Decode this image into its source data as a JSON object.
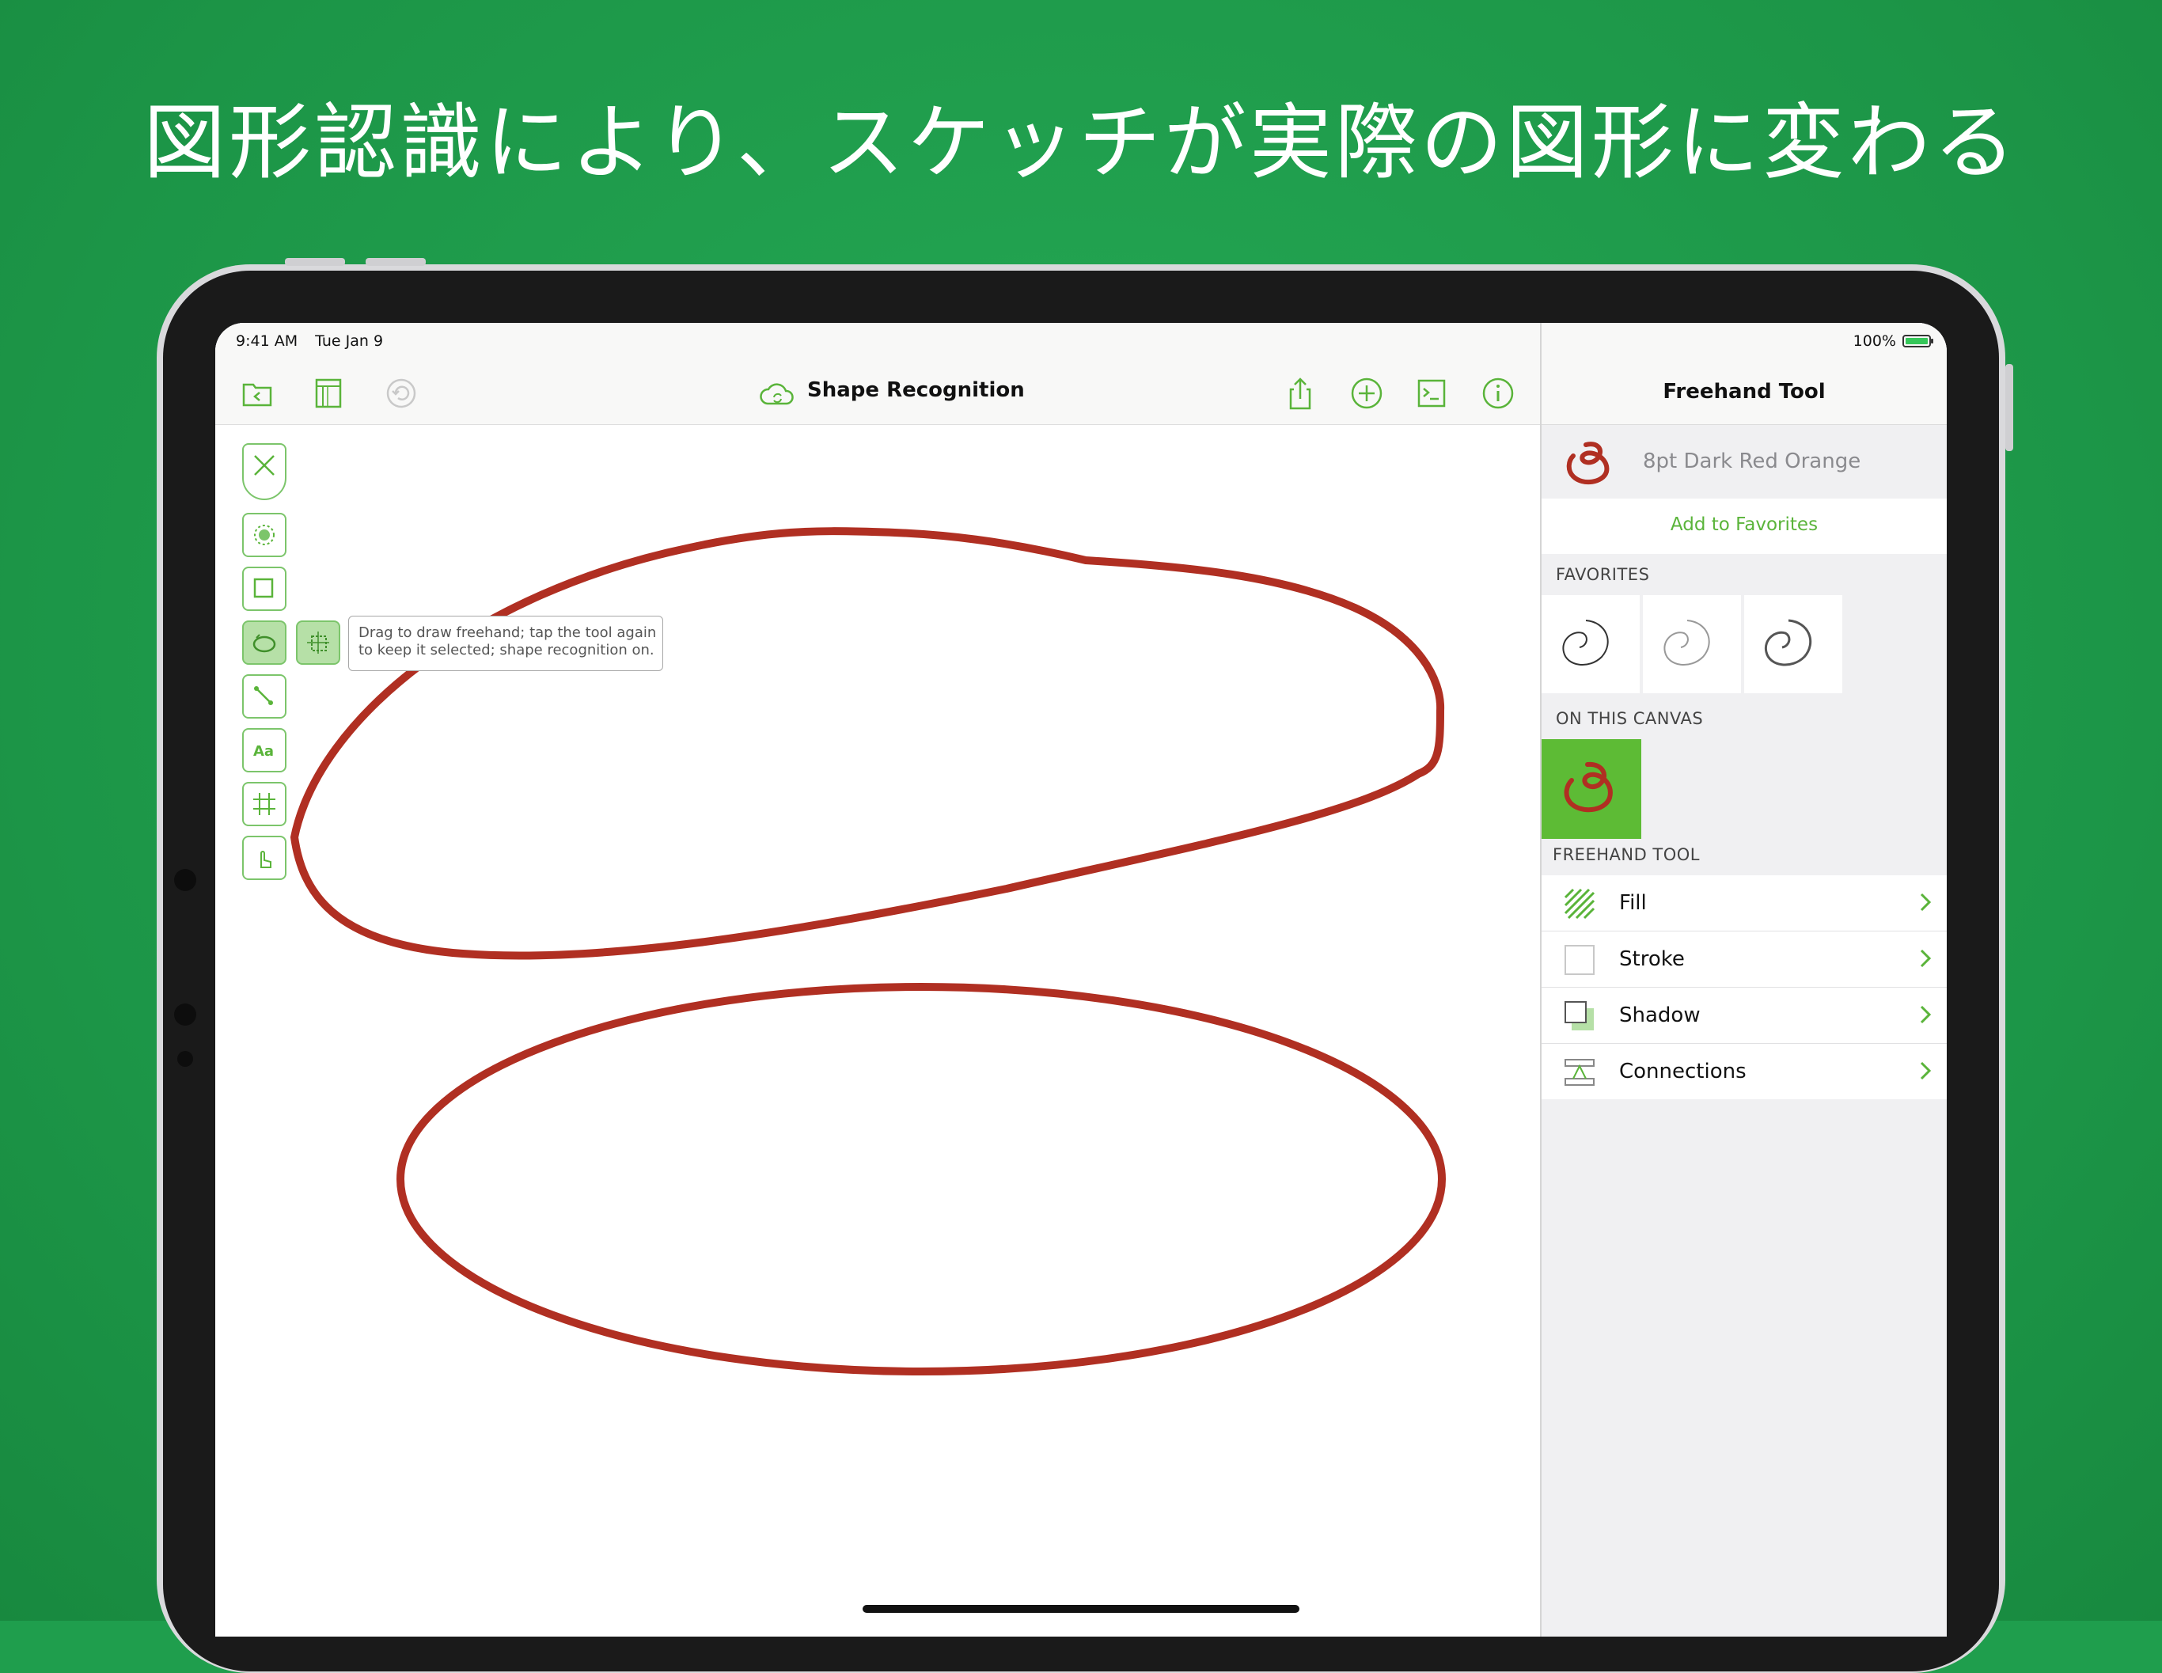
{
  "headline": "図形認識により、スケッチが実際の図形に変わる",
  "status": {
    "time": "9:41 AM",
    "date": "Tue Jan 9",
    "battery": "100%"
  },
  "document": {
    "title": "Shape Recognition"
  },
  "tooltip": {
    "line1": "Drag to draw freehand; tap the tool again",
    "line2": "to keep it selected; shape recognition on."
  },
  "inspector": {
    "title": "Freehand Tool",
    "current_style": "8pt Dark Red Orange",
    "add_favorites": "Add to Favorites",
    "favorites_label": "FAVORITES",
    "on_canvas_label": "ON THIS CANVAS",
    "tool_section_label": "FREEHAND TOOL",
    "items": [
      {
        "label": "Fill",
        "icon": "fill-icon"
      },
      {
        "label": "Stroke",
        "icon": "stroke-icon"
      },
      {
        "label": "Shadow",
        "icon": "shadow-icon"
      },
      {
        "label": "Connections",
        "icon": "connections-icon"
      }
    ]
  },
  "colors": {
    "background": "#1f9e4d",
    "accent": "#5ab43a",
    "stroke": "#b02f22"
  }
}
